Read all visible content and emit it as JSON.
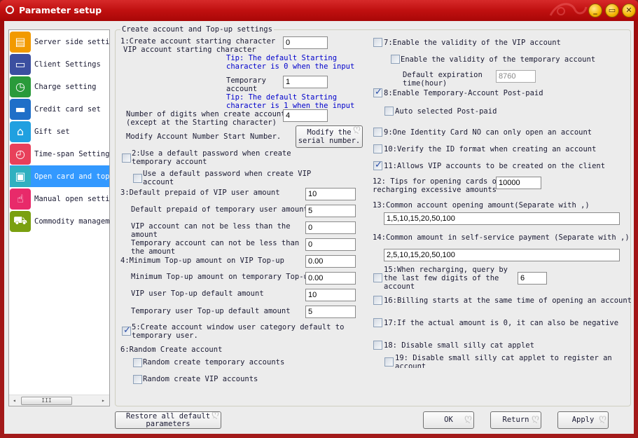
{
  "window": {
    "title": "Parameter setup",
    "controls": {
      "minimize": "_",
      "maximize": "▭",
      "close": "✕"
    }
  },
  "sidebar": {
    "items": [
      {
        "label": "Server side settings",
        "icon": "server-icon",
        "color": "#f29a00",
        "glyph": "▤"
      },
      {
        "label": "Client Settings",
        "icon": "monitor-icon",
        "color": "#3b4fa0",
        "glyph": "▭"
      },
      {
        "label": "Charge setting",
        "icon": "clock-coins-icon",
        "color": "#2a9a3a",
        "glyph": "◷"
      },
      {
        "label": "Credit card set",
        "icon": "credit-card-icon",
        "color": "#1f6fc8",
        "glyph": "▬"
      },
      {
        "label": "Gift set",
        "icon": "gift-icon",
        "color": "#20a0e0",
        "glyph": "⌂"
      },
      {
        "label": "Time-span Setting",
        "icon": "alarm-clock-icon",
        "color": "#e8405a",
        "glyph": "◴"
      },
      {
        "label": "Open card and top",
        "icon": "id-card-icon",
        "color": "#2fb0c0",
        "glyph": "▣",
        "selected": true
      },
      {
        "label": "Manual open settings",
        "icon": "hand-pointer-icon",
        "color": "#e82a6a",
        "glyph": "☝"
      },
      {
        "label": "Commodity management",
        "icon": "shopping-cart-icon",
        "color": "#7aa010",
        "glyph": "⛟"
      }
    ],
    "scrollbar": {
      "left": "◂",
      "right": "▸",
      "thumb": "III"
    }
  },
  "group_title": "Create account and Top-up settings",
  "left": {
    "s1_label_a": "1:Create account starting character",
    "s1_label_b": "VIP account starting character",
    "vip_start_char": "0",
    "tip1_a": "Tip: The default Starting",
    "tip1_b": "character is 0 when the input",
    "temp_label_a": "Temporary",
    "temp_label_b": "account",
    "temp_start_char": "1",
    "tip2_a": "Tip: The default Starting",
    "tip2_b": "character is 1 when the input",
    "digits_label_a": "Number of digits when create account",
    "digits_label_b": "(except at the Starting character)",
    "digits": "4",
    "modify_label": "Modify Account Number Start Number.",
    "modify_button_a": "Modify the",
    "modify_button_b": "serial number.",
    "s2_label_a": "2:Use a default password when create",
    "s2_label_b": "temporary account",
    "s2_checked": false,
    "s2b_label_a": "Use a default password when create VIP",
    "s2b_label_b": "account",
    "s2b_checked": false,
    "s3_label": "3:Default prepaid of VIP user amount",
    "s3_vip_prepaid": "10",
    "temp_prepaid_label": "Default prepaid of temporary user amount",
    "temp_prepaid": "5",
    "vip_min_label_a": "VIP account can not be less than the",
    "vip_min_label_b": "amount",
    "vip_min": "0",
    "temp_min_label_a": "Temporary account can not be less than",
    "temp_min_label_b": "the amount",
    "temp_min": "0",
    "s4_label": "4:Minimum Top-up amount on VIP Top-up",
    "s4_vip_min_topup": "0.00",
    "temp_min_topup_label": "Minimum Top-up amount on temporary Top-up",
    "temp_min_topup": "0.00",
    "vip_topup_default_label": "VIP user Top-up default amount",
    "vip_topup_default": "10",
    "temp_topup_default_label": "Temporary user Top-up default amount",
    "temp_topup_default": "5",
    "s5_label_a": "5:Create account window user category default to",
    "s5_label_b": "temporary user.",
    "s5_checked": true,
    "s6_label": "6:Random Create account",
    "s6a_label": "Random create temporary accounts",
    "s6a_checked": false,
    "s6b_label": "Random create VIP accounts",
    "s6b_checked": false
  },
  "right": {
    "s7_label": "7:Enable the validity of the VIP account",
    "s7_checked": false,
    "s7b_label": "Enable the validity of the temporary account",
    "s7b_checked": false,
    "expire_label_a": "Default expiration",
    "expire_label_b": "time(hour)",
    "expire_hours": "8760",
    "s8_label": "8:Enable Temporary-Account Post-paid",
    "s8_checked": true,
    "s8b_label": "Auto selected Post-paid",
    "s8b_checked": false,
    "s9_label": "9:One Identity Card NO can only open an account",
    "s9_checked": false,
    "s10_label": "10:Verify the ID format when creating an account",
    "s10_checked": false,
    "s11_label": "11:Allows VIP accounts to be created on the client",
    "s11_checked": true,
    "s12_label_a": "12: Tips for opening cards or",
    "s12_label_b": "recharging excessive amounts",
    "s12_value": "10000",
    "s13_label": "13:Common account opening amount(Separate with ,)",
    "s13_value": "1,5,10,15,20,50,100",
    "s14_label": "14:Common amount in self-service payment (Separate with ,)",
    "s14_value": "2,5,10,15,20,50,100",
    "s15_label_a": "15:When recharging, query by",
    "s15_label_b": "the last few digits of the",
    "s15_label_c": "account",
    "s15_checked": false,
    "s15_value": "6",
    "s16_label": "16:Billing starts at the same time of opening an account",
    "s16_checked": false,
    "s17_label": "17:If the actual amount is 0, it can also be negative",
    "s17_checked": false,
    "s18_label": "18: Disable small silly cat applet",
    "s18_checked": false,
    "s19_label_a": "19: Disable small silly cat applet to register an",
    "s19_label_b": "account",
    "s19_checked": false
  },
  "footer": {
    "restore_a": "Restore all default",
    "restore_b": "parameters",
    "ok": "OK",
    "return": "Return",
    "apply": "Apply"
  }
}
